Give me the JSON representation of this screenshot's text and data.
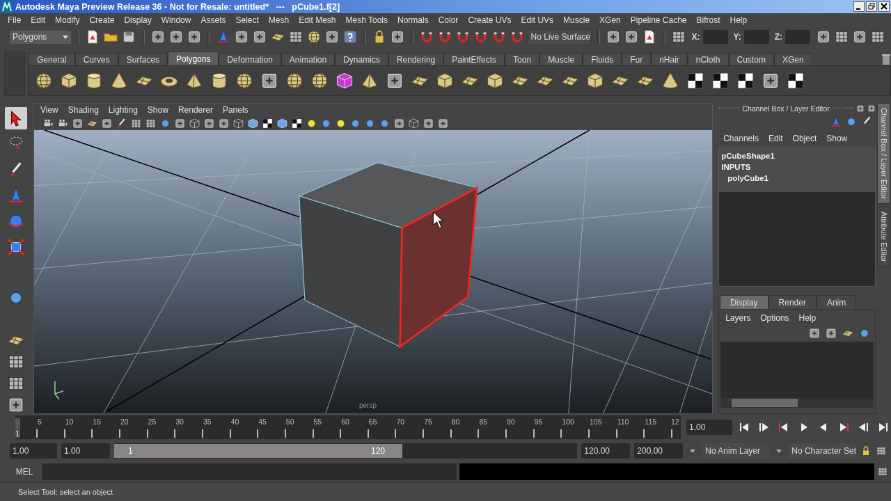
{
  "window": {
    "title": "Autodesk Maya Preview Release 36 - Not for Resale: untitled*   ---   pCube1.f[2]"
  },
  "menu_bar": [
    "File",
    "Edit",
    "Modify",
    "Create",
    "Display",
    "Window",
    "Assets",
    "Select",
    "Mesh",
    "Edit Mesh",
    "Mesh Tools",
    "Normals",
    "Color",
    "Create UVs",
    "Edit UVs",
    "Muscle",
    "XGen",
    "Pipeline Cache",
    "Bifrost",
    "Help"
  ],
  "status_line": {
    "menu_set": "Polygons",
    "live_surface": "No Live Surface",
    "coord_labels": [
      "X:",
      "Y:",
      "Z:"
    ]
  },
  "shelf": {
    "tabs": [
      {
        "label": "General",
        "selected": false
      },
      {
        "label": "Curves",
        "selected": false
      },
      {
        "label": "Surfaces",
        "selected": false
      },
      {
        "label": "Polygons",
        "selected": true
      },
      {
        "label": "Deformation",
        "selected": false
      },
      {
        "label": "Animation",
        "selected": false
      },
      {
        "label": "Dynamics",
        "selected": false
      },
      {
        "label": "Rendering",
        "selected": false
      },
      {
        "label": "PaintEffects",
        "selected": false
      },
      {
        "label": "Toon",
        "selected": false
      },
      {
        "label": "Muscle",
        "selected": false
      },
      {
        "label": "Fluids",
        "selected": false
      },
      {
        "label": "Fur",
        "selected": false
      },
      {
        "label": "nHair",
        "selected": false
      },
      {
        "label": "nCloth",
        "selected": false
      },
      {
        "label": "Custom",
        "selected": false
      },
      {
        "label": "XGen",
        "selected": false
      }
    ]
  },
  "tools": [
    {
      "kind": "select",
      "selected": true
    },
    {
      "kind": "lasso",
      "selected": false
    },
    {
      "kind": "paint",
      "selected": false
    },
    {
      "kind": "move",
      "selected": false
    },
    {
      "kind": "rotate",
      "selected": false
    },
    {
      "kind": "scale",
      "selected": false
    },
    {
      "kind": "sphere",
      "selected": false
    }
  ],
  "viewport": {
    "menus": [
      "View",
      "Shading",
      "Lighting",
      "Show",
      "Renderer",
      "Panels"
    ],
    "camera": "persp"
  },
  "channel_box": {
    "title": "Channel Box / Layer Editor",
    "menus": [
      "Channels",
      "Edit",
      "Object",
      "Show"
    ],
    "nodes": [
      {
        "name": "pCubeShape1"
      },
      {
        "name": "INPUTS",
        "children": [
          {
            "name": "polyCube1"
          }
        ]
      }
    ]
  },
  "layer_editor": {
    "tabs": [
      {
        "label": "Display",
        "selected": true
      },
      {
        "label": "Render",
        "selected": false
      },
      {
        "label": "Anim",
        "selected": false
      }
    ],
    "menus": [
      "Layers",
      "Options",
      "Help"
    ]
  },
  "side_tabs": [
    {
      "label": "Channel Box / Layer Editor",
      "selected": true
    },
    {
      "label": "Attribute Editor",
      "selected": false
    }
  ],
  "time_slider": {
    "labels": [
      "5",
      "10",
      "15",
      "20",
      "25",
      "30",
      "35",
      "40",
      "45",
      "50",
      "55",
      "60",
      "65",
      "70",
      "75",
      "80",
      "85",
      "90",
      "95",
      "100",
      "105",
      "110",
      "115",
      "12"
    ],
    "current_frame": "1",
    "level": 0,
    "current_time": "1.00"
  },
  "range_slider": {
    "start_time": "1.00",
    "playback_start": "1.00",
    "range_start": "1",
    "range_end": "120",
    "playback_end": "120.00",
    "end_time": "200.00",
    "anim_layer": "No Anim Layer",
    "character_set": "No Character Set"
  },
  "command_line": {
    "language": "MEL"
  },
  "help_line": "Select Tool: select an object"
}
